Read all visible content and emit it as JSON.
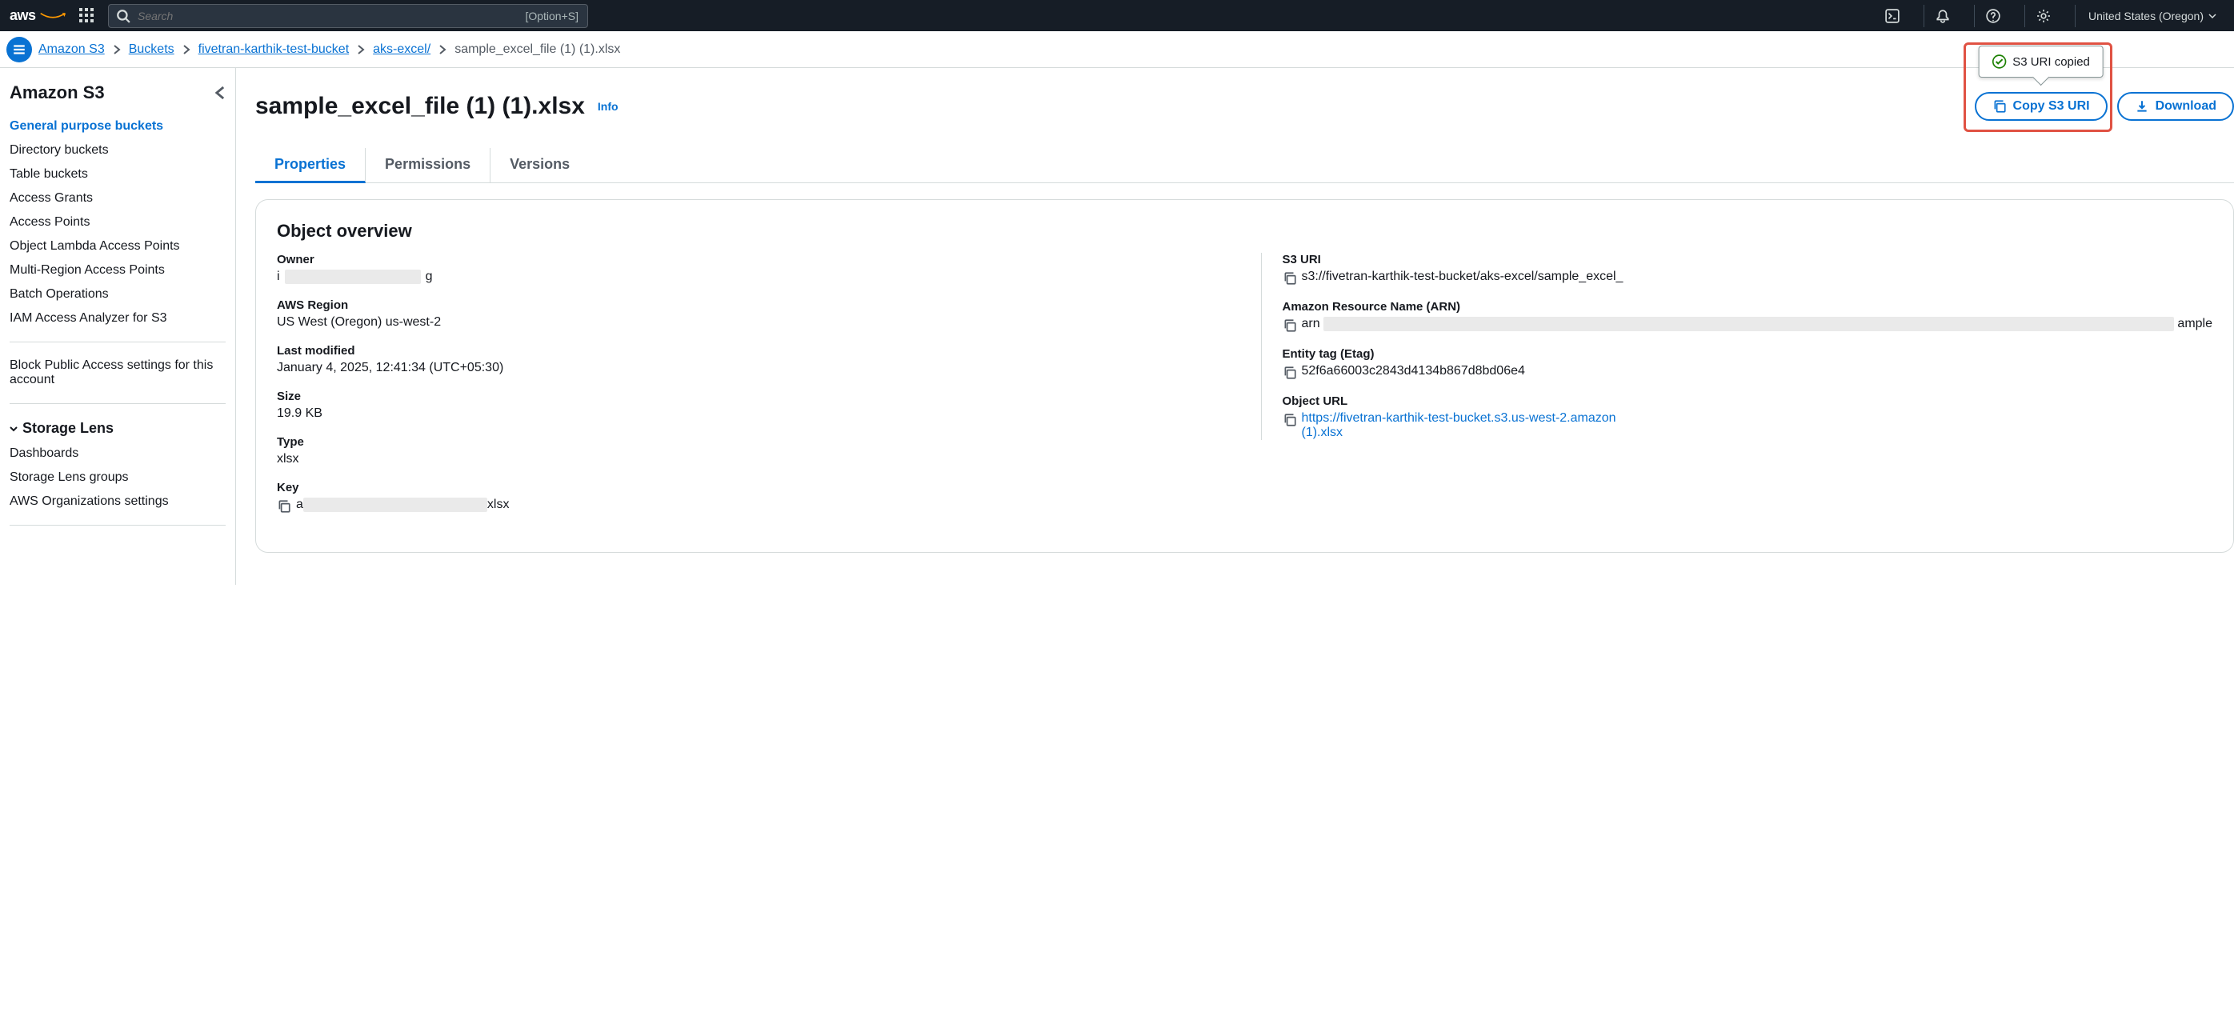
{
  "topnav": {
    "logo_text": "aws",
    "search_placeholder": "Search",
    "search_hint": "[Option+S]",
    "region": "United States (Oregon)"
  },
  "breadcrumb": {
    "items": [
      {
        "label": "Amazon S3",
        "link": true
      },
      {
        "label": "Buckets",
        "link": true
      },
      {
        "label": "fivetran-karthik-test-bucket",
        "link": true
      },
      {
        "label": "aks-excel/",
        "link": true
      },
      {
        "label": "sample_excel_file (1) (1).xlsx",
        "link": false
      }
    ]
  },
  "sidebar": {
    "title": "Amazon S3",
    "items_a": [
      "General purpose buckets",
      "Directory buckets",
      "Table buckets",
      "Access Grants",
      "Access Points",
      "Object Lambda Access Points",
      "Multi-Region Access Points",
      "Batch Operations",
      "IAM Access Analyzer for S3"
    ],
    "items_b": [
      "Block Public Access settings for this account"
    ],
    "storage_lens_heading": "Storage Lens",
    "items_c": [
      "Dashboards",
      "Storage Lens groups",
      "AWS Organizations settings"
    ]
  },
  "header": {
    "page_title": "sample_excel_file (1) (1).xlsx",
    "info_link": "Info",
    "tooltip_text": "S3 URI copied",
    "copy_button": "Copy S3 URI",
    "download_button": "Download"
  },
  "tabs": {
    "properties": "Properties",
    "permissions": "Permissions",
    "versions": "Versions"
  },
  "overview": {
    "title": "Object overview",
    "left": {
      "owner_label": "Owner",
      "owner_value_prefix": "i",
      "owner_value_suffix": "g",
      "region_label": "AWS Region",
      "region_value": "US West (Oregon) us-west-2",
      "modified_label": "Last modified",
      "modified_value": "January 4, 2025, 12:41:34 (UTC+05:30)",
      "size_label": "Size",
      "size_value": "19.9 KB",
      "type_label": "Type",
      "type_value": "xlsx",
      "key_label": "Key",
      "key_value_prefix": "a",
      "key_value_suffix": "xlsx"
    },
    "right": {
      "s3uri_label": "S3 URI",
      "s3uri_value": "s3://fivetran-karthik-test-bucket/aks-excel/sample_excel_",
      "arn_label": "Amazon Resource Name (ARN)",
      "arn_value_prefix": "arn",
      "arn_value_suffix": "ample",
      "etag_label": "Entity tag (Etag)",
      "etag_value": "52f6a66003c2843d4134b867d8bd06e4",
      "url_label": "Object URL",
      "url_value_line1": "https://fivetran-karthik-test-bucket.s3.us-west-2.amazon",
      "url_value_line2": "(1).xlsx"
    }
  }
}
